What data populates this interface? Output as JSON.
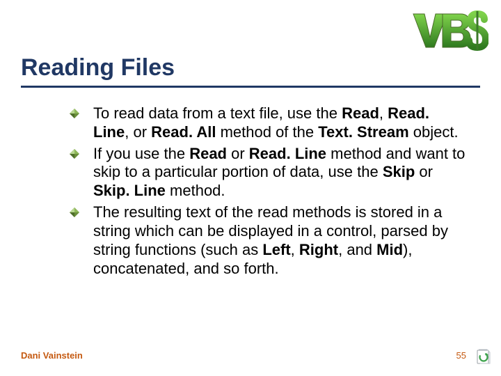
{
  "title": "Reading Files",
  "logo_text": "VBS",
  "bullets": [
    {
      "parts": [
        {
          "t": "To read data from a text file, use the ",
          "b": false
        },
        {
          "t": "Read",
          "b": true
        },
        {
          "t": ", ",
          "b": false
        },
        {
          "t": "Read. Line",
          "b": true
        },
        {
          "t": ", or ",
          "b": false
        },
        {
          "t": "Read. All",
          "b": true
        },
        {
          "t": " method of the ",
          "b": false
        },
        {
          "t": "Text. Stream",
          "b": true
        },
        {
          "t": " object.",
          "b": false
        }
      ]
    },
    {
      "parts": [
        {
          "t": "If you use the ",
          "b": false
        },
        {
          "t": "Read",
          "b": true
        },
        {
          "t": " or ",
          "b": false
        },
        {
          "t": "Read. Line",
          "b": true
        },
        {
          "t": " method and want to skip to a particular portion of data, use the ",
          "b": false
        },
        {
          "t": "Skip",
          "b": true
        },
        {
          "t": " or ",
          "b": false
        },
        {
          "t": "Skip. Line",
          "b": true
        },
        {
          "t": " method.",
          "b": false
        }
      ]
    },
    {
      "parts": [
        {
          "t": "The resulting text of the read methods is stored in a string which can be displayed in a control, parsed by string functions (such as ",
          "b": false
        },
        {
          "t": "Left",
          "b": true
        },
        {
          "t": ", ",
          "b": false
        },
        {
          "t": "Right",
          "b": true
        },
        {
          "t": ", and ",
          "b": false
        },
        {
          "t": "Mid",
          "b": true
        },
        {
          "t": "), concatenated, and so forth.",
          "b": false
        }
      ]
    }
  ],
  "footer": {
    "author": "Dani Vainstein",
    "page": "55"
  }
}
